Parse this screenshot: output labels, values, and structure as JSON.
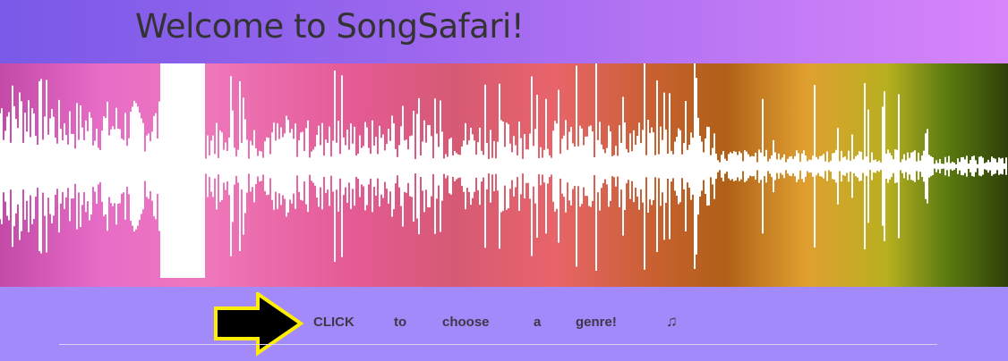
{
  "header": {
    "title": "Welcome to SongSafari!"
  },
  "prompt": {
    "words": [
      "CLICK",
      "to",
      "choose",
      "a",
      "genre!"
    ],
    "icon": "music-note-icon"
  },
  "colors": {
    "background": "#a38afa",
    "arrow_fill": "#000000",
    "arrow_outline": "#ffee00"
  }
}
